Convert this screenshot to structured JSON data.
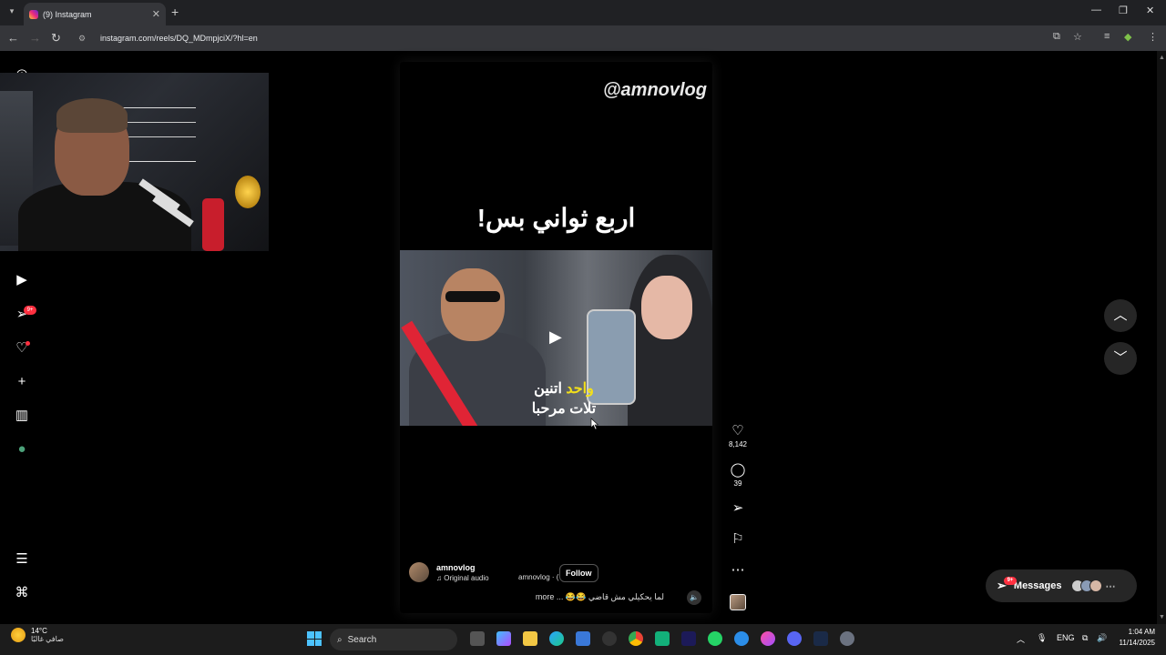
{
  "browser": {
    "tab_title": "(9) Instagram",
    "tab_close": "✕",
    "new_tab": "+",
    "url": "instagram.com/reels/DQ_MDmpjciX/?hl=en"
  },
  "reel": {
    "watermark": "@amnovlog",
    "headline": "اربع ثواني بس!",
    "subtitle_line1_highlight": "واحد",
    "subtitle_line1_rest": " اتنين",
    "subtitle_line2": "تلات مرحبا",
    "username": "amnovlog",
    "audio_label": "Original audio",
    "audio_ticker": "amnovlog · (",
    "follow_label": "Follow",
    "caption": "لما يحكيلي مش قاضي 😂😂 ... more"
  },
  "actions": {
    "likes": "8,142",
    "comments": "39"
  },
  "sidebar": {
    "notifications_badge": "9+"
  },
  "messages": {
    "label": "Messages",
    "badge": "9+"
  },
  "taskbar": {
    "temperature": "14°C",
    "weather_condition": "صافي غالبًا",
    "search_label": "Search",
    "language": "ENG",
    "time": "1:04 AM",
    "date": "11/14/2025"
  },
  "colors": {
    "accent_red": "#ff3040",
    "subtitle_yellow": "#f2df1a",
    "seatbelt_red": "#e02435"
  }
}
